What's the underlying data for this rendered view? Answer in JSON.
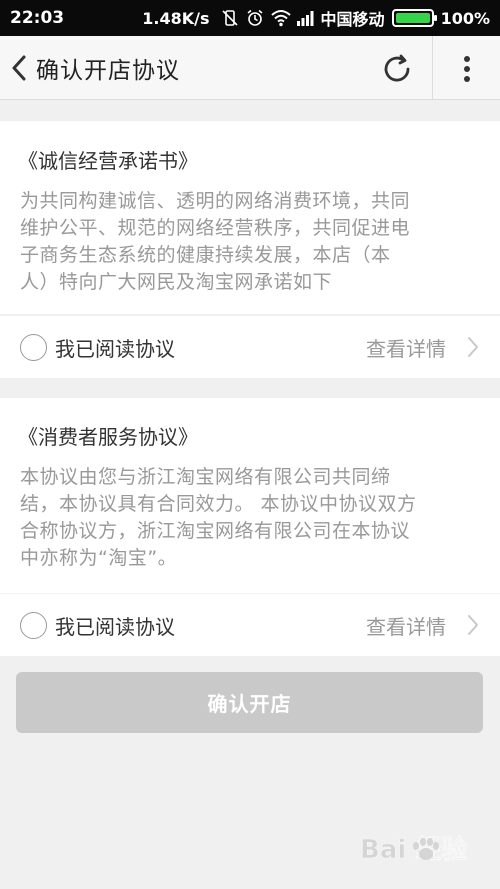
{
  "status_bar": {
    "time": "22:03",
    "speed": "1.48K/s",
    "carrier": "中国移动",
    "battery": "100%",
    "battery_level": 1.0
  },
  "header": {
    "title": "确认开店协议"
  },
  "agreements": [
    {
      "title": "《诚信经营承诺书》",
      "lines": [
        "为共同构建诚信、透明的网络消费环境，共同",
        "维护公平、规范的网络经营秩序，共同促进电",
        "子商务生态系统的健康持续发展，本店（本",
        "人）特向广大网民及淘宝网承诺如下"
      ],
      "read_label": "我已阅读协议",
      "detail_label": "查看详情"
    },
    {
      "title": "《消费者服务协议》",
      "lines": [
        "本协议由您与浙江淘宝网络有限公司共同缔",
        "结，本协议具有合同效力。 本协议中协议双方",
        "合称协议方，浙江淘宝网络有限公司在本协议",
        "中亦称为“淘宝”。"
      ],
      "read_label": "我已阅读协议",
      "detail_label": "查看详情"
    }
  ],
  "confirm_button": {
    "label": "确认开店"
  },
  "watermark": {
    "text": "Bai 经验"
  }
}
